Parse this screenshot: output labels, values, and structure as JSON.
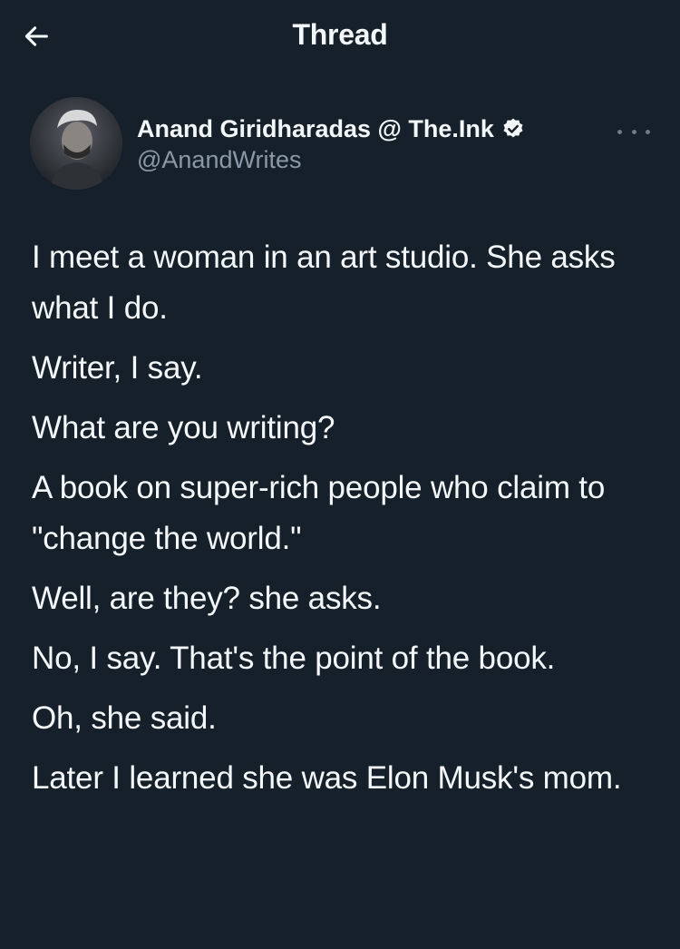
{
  "header": {
    "title": "Thread",
    "back_icon": "arrow-left-icon"
  },
  "author": {
    "display_name": "Anand Giridharadas @ The.Ink",
    "handle": "@AnandWrites",
    "verified_icon": "verified-badge-icon",
    "more_icon": "more-options-icon"
  },
  "tweet": {
    "paragraphs": [
      "I meet a woman in an art studio. She asks what I do.",
      "Writer, I say.",
      "What are you writing?",
      "A book on super-rich people who claim to \"change the world.\"",
      "Well, are they? she asks.",
      "No, I say. That's the point of the book.",
      "Oh, she said.",
      "Later I learned she was Elon Musk's mom."
    ]
  },
  "colors": {
    "background": "#16202b",
    "text": "#f5f8fa",
    "muted": "#8b98a5"
  }
}
